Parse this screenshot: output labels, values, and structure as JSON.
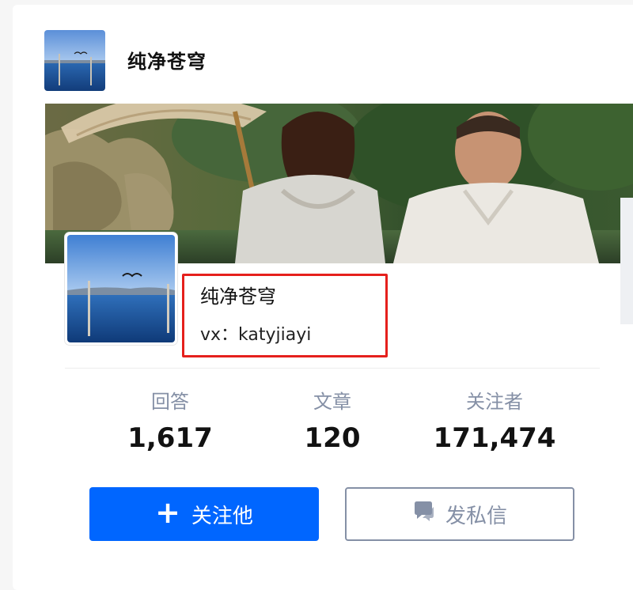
{
  "header": {
    "name": "纯净苍穹"
  },
  "profile": {
    "name": "纯净苍穹",
    "bio": "vx：katyjiayi"
  },
  "stats": [
    {
      "label": "回答",
      "value": "1,617"
    },
    {
      "label": "文章",
      "value": "120"
    },
    {
      "label": "关注者",
      "value": "171,474"
    }
  ],
  "buttons": {
    "follow_label": "关注他",
    "follow_icon": "plus-icon",
    "message_label": "发私信",
    "message_icon": "chat-bubble-icon"
  },
  "colors": {
    "accent": "#0066ff",
    "highlight_box": "#e5201c",
    "muted_text": "#8590a6"
  }
}
